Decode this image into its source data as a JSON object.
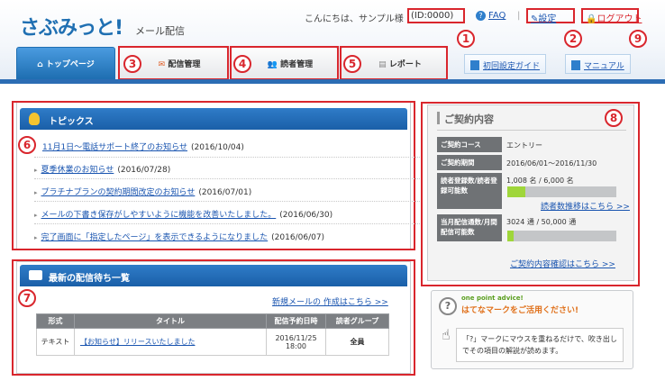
{
  "header": {
    "logo": "さぶみっと!",
    "logo_sub": "メール配信",
    "greeting": "こんにちは、サンプル様",
    "user_id": "(ID:0000)",
    "faq": "FAQ",
    "settings": "設定",
    "logout": "ログアウト"
  },
  "tabs": [
    {
      "label": "トップページ"
    },
    {
      "label": "配信管理"
    },
    {
      "label": "読者管理"
    },
    {
      "label": "レポート"
    }
  ],
  "guides": {
    "initial_setup": "初回設定ガイド",
    "manual": "マニュアル"
  },
  "annotations": [
    "1",
    "2",
    "3",
    "4",
    "5",
    "6",
    "7",
    "8",
    "9"
  ],
  "topics": {
    "title": "トピックス",
    "items": [
      {
        "text": "11月1日～電話サポート終了のお知らせ",
        "date": "(2016/10/04)"
      },
      {
        "text": "夏季休業のお知らせ",
        "date": "(2016/07/28)"
      },
      {
        "text": "プラチナプランの契約期間改定のお知らせ",
        "date": "(2016/07/01)"
      },
      {
        "text": "メールの下書き保存がしやすいように機能を改善いたしました。",
        "date": "(2016/06/30)"
      },
      {
        "text": "完了画面に「指定したページ」を表示できるようになりました",
        "date": "(2016/06/07)"
      }
    ]
  },
  "queue": {
    "title": "最新の配信待ち一覧",
    "new_mail_link": "新規メールの 作成はこちら >>",
    "columns": [
      "形式",
      "タイトル",
      "配信予約日時",
      "読者グループ"
    ],
    "rows": [
      {
        "format": "テキスト",
        "title": "【お知らせ】リリースいたしました",
        "date": "2016/11/25",
        "time": "18:00",
        "group": "全員"
      }
    ]
  },
  "contract": {
    "title": "ご契約内容",
    "course_label": "ご契約コース",
    "course_value": "エントリー",
    "period_label": "ご契約期間",
    "period_value": "2016/06/01～2016/11/30",
    "readers_label": "読者登録数/読者登録可能数",
    "readers_value": "1,008 名 / 6,000 名",
    "readers_fill": 0.168,
    "readers_link": "読者数推移はこちら >>",
    "sends_label": "当月配信通数/月間配信可能数",
    "sends_value": "3024 通 / 50,000 通",
    "sends_fill": 0.06,
    "confirm_link": "ご契約内容確認はこちら >>"
  },
  "advice": {
    "en": "one point advice!",
    "jp": "はてなマークをご活用ください!",
    "body": "「?」マークにマウスを重ねるだけで、吹き出しでその項目の解説が読めます。"
  },
  "colors": {
    "accent": "#1f6fb2",
    "annotation": "#d9262d",
    "progress": "#9fd63a"
  }
}
